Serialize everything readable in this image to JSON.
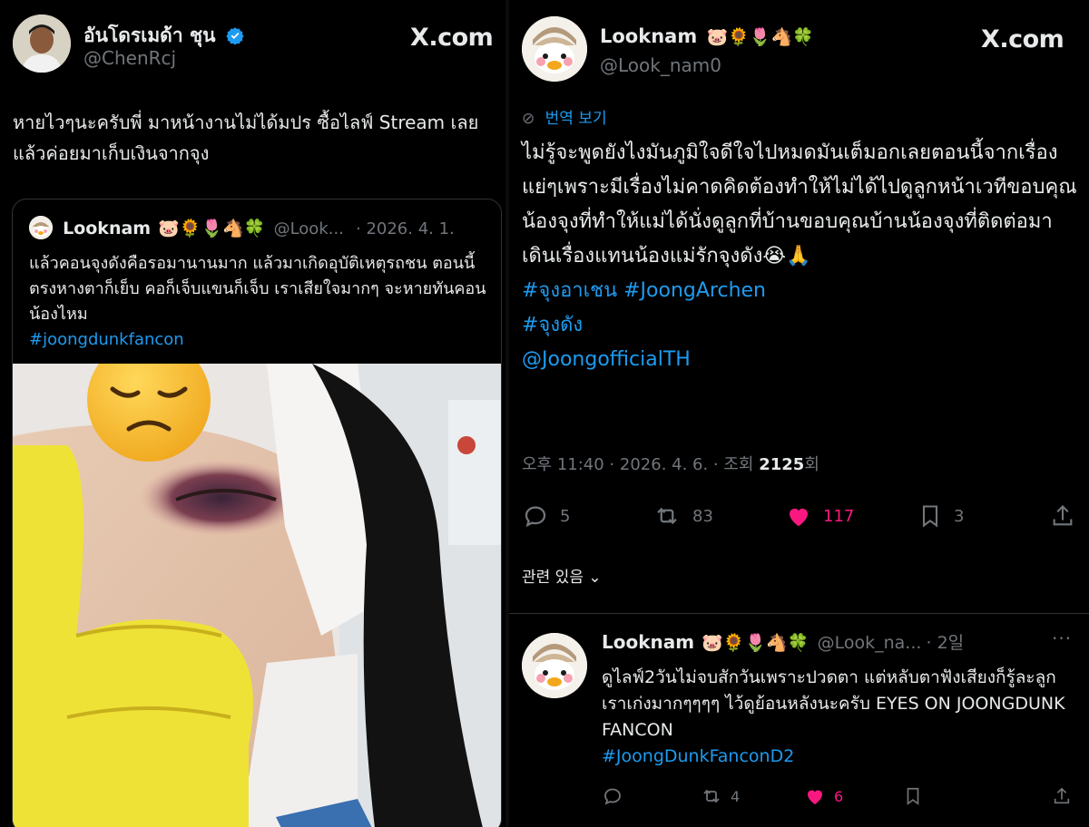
{
  "left_post": {
    "display_name": "อันโดรเมด้า ชุน",
    "handle": "@ChenRcj",
    "site": "X.com",
    "text": "หายไวๆนะครับพี่ มาหน้างานไม่ได้มปร ซื้อไลฟ์ Stream เลย แล้วค่อยมาเก็บเงินจากจุง",
    "quote": {
      "display_name": "Looknam",
      "emojis": "🐷🌻🌷🐴🍀",
      "handle": "@Look...",
      "date": "· 2026. 4. 1.",
      "text": "แล้วคอนจุงดังคือรอมานานมาก แล้วมาเกิดอุบัติเหตุรถชน ตอนนี้ ตรงหางตาก็เย็บ คอก็เจ็บแขนก็เจ็บ เราเสียใจมากๆ จะหายทันคอนน้องไหม",
      "hashtag": "#joongdunkfancon",
      "overlay_emoji": "😞"
    }
  },
  "right_post": {
    "display_name": "Looknam",
    "emojis": "🐷🌻🌷🐴🍀",
    "handle": "@Look_nam0",
    "site": "X.com",
    "translate_label": "번역 보기",
    "text": "ไม่รู้จะพูดยังไงมันภูมิใจดีใจไปหมดมันเต็มอกเลยตอนนี้จากเรื่องแย่ๆเพราะมีเรื่องไม่คาดคิดต้องทำให้ไม่ได้ไปดูลูกหน้าเวทีขอบคุณน้องจุงที่ทำให้แม่ได้นั่งดูลูกที่บ้านขอบคุณบ้านน้องจุงที่ติดต่อมาเดินเรื่องแทนน้องแม่รักจุงดัง😭🙏",
    "tags": [
      "#จุงอาเชน #JoongArchen",
      "#จุงดัง",
      "@JoongofficialTH"
    ],
    "meta_prefix": "오후 11:40 · 2026. 4. 6. · 조회",
    "views": "2125",
    "views_suffix": "회",
    "counts": {
      "replies": "5",
      "reposts": "83",
      "likes": "117",
      "bookmarks": "3"
    },
    "related_label": "관련 있음",
    "reply": {
      "display_name": "Looknam",
      "emojis": "🐷🌻🌷🐴🍀",
      "handle": "@Look_na...",
      "age": "· 2일",
      "text": "ดูไลฟ์2วันไม่จบสักวันเพราะปวดตา แต่หลับตาฟังเสียงก็รู้ละลูกเราเก่งมากๆๆๆๆ ไว้ดูย้อนหลังนะครับ EYES ON JOONGDUNK FANCON",
      "hashtag": "#JoongDunkFanconD2",
      "counts": {
        "replies": "",
        "reposts": "4",
        "likes": "6"
      }
    }
  },
  "colors": {
    "accent": "#1d9bf0",
    "like": "#f91880",
    "muted": "#71767b",
    "text": "#e7e9ea"
  }
}
